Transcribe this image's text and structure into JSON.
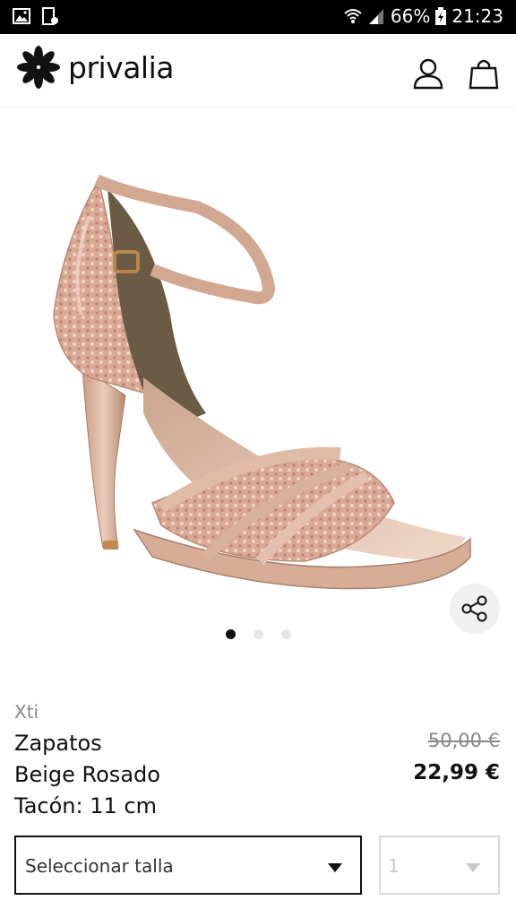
{
  "status_bar": {
    "battery": "66%",
    "time": "21:23",
    "icons": [
      "gallery-icon",
      "screenshot-icon",
      "wifi-icon",
      "signal-icon",
      "battery-icon"
    ]
  },
  "header": {
    "logo_text": "privalia",
    "icons": [
      "privalia-flower-logo",
      "user-icon",
      "shopping-bag-icon"
    ]
  },
  "gallery": {
    "image_count": 3,
    "active_index": 0,
    "icons": [
      "share-icon"
    ]
  },
  "product": {
    "brand": "Xti",
    "name_lines": [
      "Zapatos",
      "Beige Rosado",
      "Tacón: 11 cm"
    ],
    "old_price": "50,00 €",
    "price": "22,99 €"
  },
  "selectors": {
    "size_placeholder": "Seleccionar talla",
    "quantity_value": "1"
  },
  "colors": {
    "status_bar": "#000000",
    "text": "#111111",
    "muted": "#888888",
    "disabled": "#c8c8c8"
  }
}
